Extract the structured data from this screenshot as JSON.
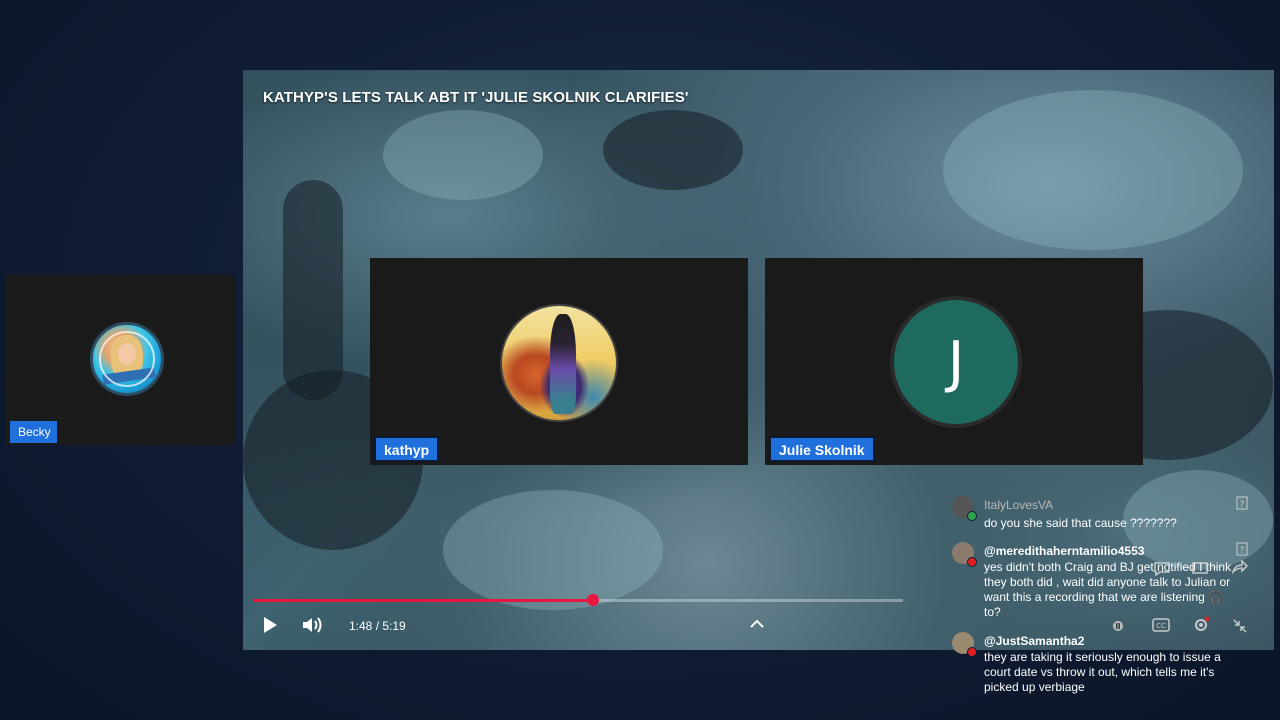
{
  "side_participant": {
    "name": "Becky"
  },
  "video": {
    "title": "KATHYP'S LETS TALK ABT IT 'JULIE SKOLNIK CLARIFIES'",
    "participants": [
      {
        "name": "kathyp",
        "avatar": "illustrated-woman-avatar"
      },
      {
        "name": "Julie Skolnik",
        "avatar_letter": "J",
        "avatar_color": "#1e6a5e"
      }
    ],
    "player": {
      "current_time": "1:48",
      "separator": " / ",
      "duration": "5:19",
      "progress_fraction": 0.523,
      "progress_color": "#e8173f"
    }
  },
  "chat": {
    "messages": [
      {
        "user": "ItalyLovesVA",
        "text": "do you she said that cause ???????"
      },
      {
        "user": "@meredithaherntamilio4553",
        "text": "yes didn't both Craig and BJ get notified I think they both did , wait did anyone talk to Julian or want this a recording that we are listening 🎧 to?"
      },
      {
        "user": "@JustSamantha2",
        "text": "they are taking it seriously enough to issue a court date vs throw it out, which tells me it's picked up verbiage"
      }
    ]
  },
  "colors": {
    "background": "#0f1c33",
    "badge": "#1f6fdc",
    "tile": "#1a1a1a"
  }
}
